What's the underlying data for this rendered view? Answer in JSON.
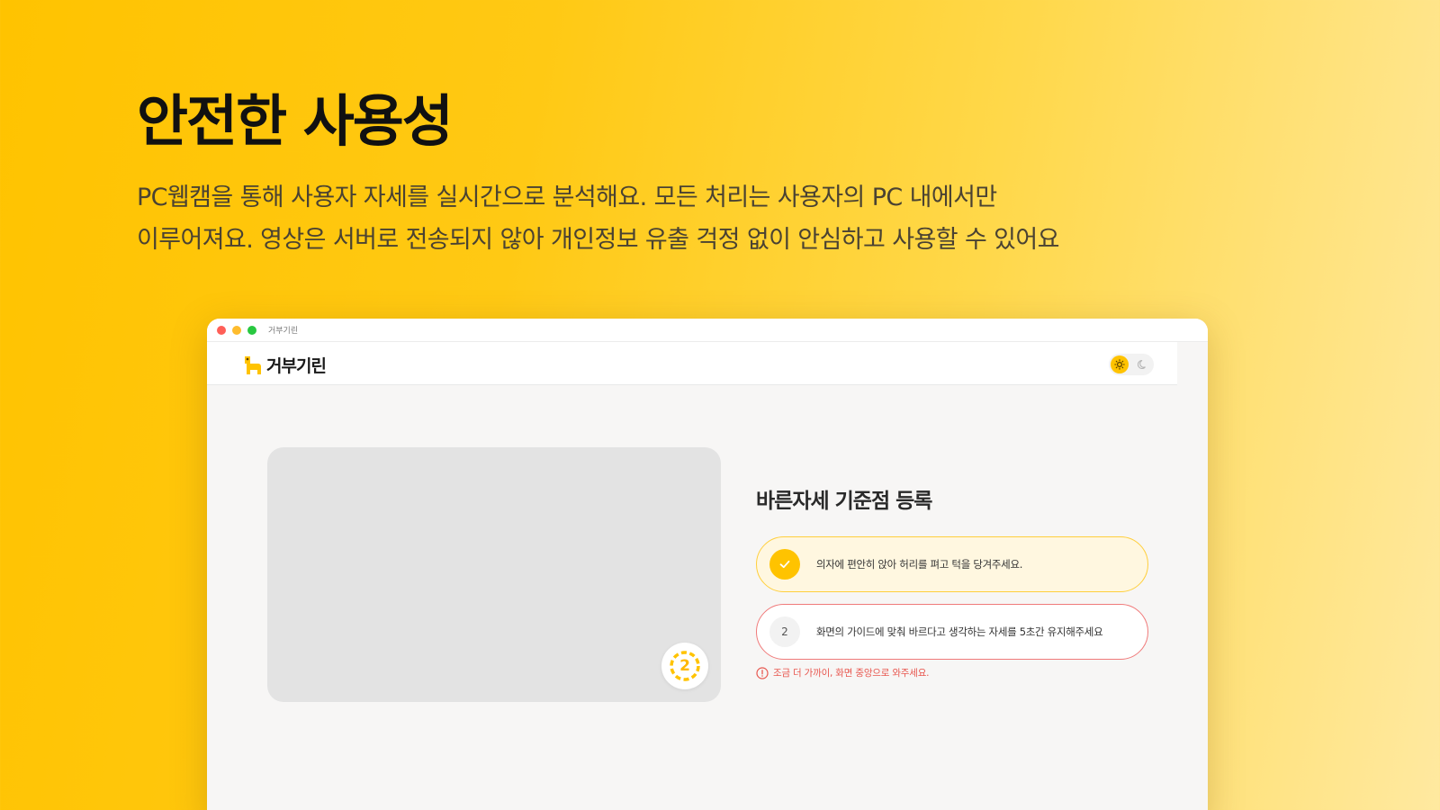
{
  "hero": {
    "title": "안전한 사용성",
    "description_line1": "PC웹캠을 통해 사용자 자세를 실시간으로 분석해요. 모든 처리는 사용자의 PC 내에서만",
    "description_line2": "이루어져요. 영상은 서버로 전송되지 않아 개인정보 유출 걱정 없이 안심하고 사용할 수 있어요"
  },
  "window": {
    "title": "거부기린",
    "app_name": "거부기린",
    "theme": {
      "active": "light",
      "icons": [
        "sun-icon",
        "moon-icon"
      ]
    }
  },
  "camera": {
    "countdown": "2"
  },
  "panel": {
    "title": "바른자세 기준점 등록",
    "steps": [
      {
        "status": "done",
        "badge": "check-icon",
        "text": "의자에 편안히 앉아 허리를 펴고 턱을 당겨주세요."
      },
      {
        "status": "active",
        "badge": "2",
        "text": "화면의 가이드에 맞춰 바르다고 생각하는 자세를 5초간 유지해주세요"
      }
    ],
    "warning": "조금 더 가까이, 화면 중앙으로 와주세요."
  },
  "colors": {
    "accent": "#ffc300",
    "warning": "#e8574f",
    "active_step_border": "#f07a7a"
  }
}
